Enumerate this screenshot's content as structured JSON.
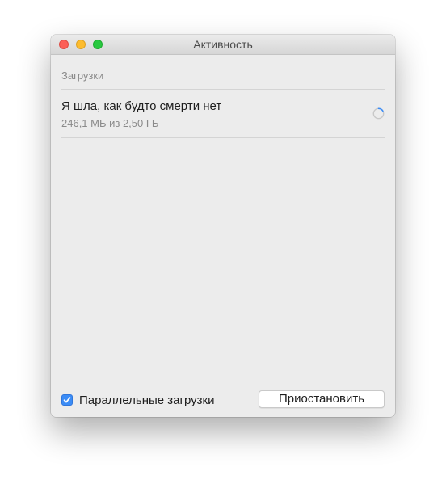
{
  "window": {
    "title": "Активность"
  },
  "section": {
    "header": "Загрузки"
  },
  "downloads": [
    {
      "title": "Я шла, как будто смерти нет",
      "progress_text": "246,1 МБ из 2,50 ГБ",
      "status_icon": "spinner-icon"
    }
  ],
  "footer": {
    "parallel_downloads_label": "Параллельные загрузки",
    "parallel_downloads_checked": true,
    "pause_button_label": "Приостановить"
  },
  "colors": {
    "close": "#fc5f57",
    "minimize": "#fdbc2e",
    "zoom": "#29c940",
    "accent": "#3b8cf6"
  }
}
